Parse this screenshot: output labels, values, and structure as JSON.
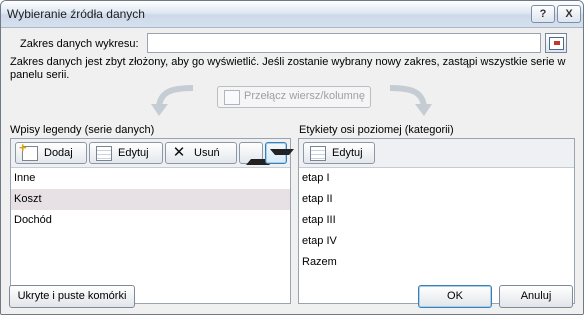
{
  "window": {
    "title": "Wybieranie źródła danych",
    "help_label": "?",
    "close_label": "X"
  },
  "range": {
    "label": "Zakres danych wykresu:",
    "value": ""
  },
  "message": "Zakres danych jest zbyt złożony, aby go wyświetlić. Jeśli zostanie wybrany nowy zakres, zastąpi wszystkie serie w panelu serii.",
  "switch_button": "Przełącz wiersz/kolumnę",
  "legend": {
    "title": "Wpisy legendy (serie danych)",
    "add_label": "Dodaj",
    "edit_label": "Edytuj",
    "remove_label": "Usuń",
    "items": [
      "Inne",
      "Koszt",
      "Dochód"
    ],
    "selected_index": 1
  },
  "axis": {
    "title": "Etykiety osi poziomej (kategorii)",
    "edit_label": "Edytuj",
    "items": [
      "etap I",
      "etap II",
      "etap III",
      "etap IV",
      "Razem"
    ]
  },
  "buttons": {
    "hidden_cells": "Ukryte i puste komórki",
    "ok": "OK",
    "cancel": "Anuluj"
  }
}
